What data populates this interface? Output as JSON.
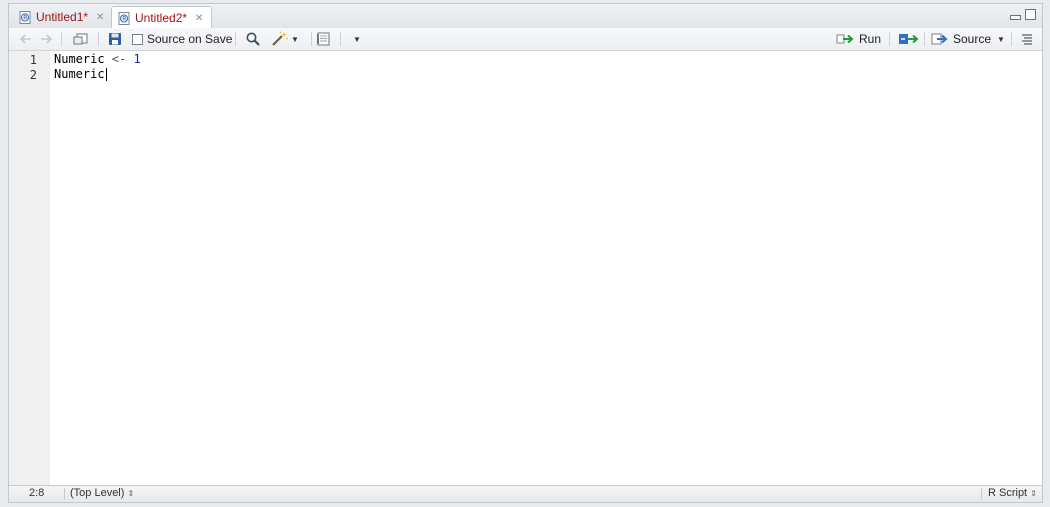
{
  "tabs": [
    {
      "label": "Untitled1*",
      "active": false
    },
    {
      "label": "Untitled2*",
      "active": true
    }
  ],
  "toolbar": {
    "source_on_save_label": "Source on Save",
    "source_on_save_checked": false,
    "run_label": "Run",
    "source_label": "Source"
  },
  "editor": {
    "line_numbers": [
      "1",
      "2"
    ],
    "lines": [
      {
        "ident": "Numeric",
        "op": " <- ",
        "num": "1"
      },
      {
        "ident": "Numeric",
        "op": "",
        "num": ""
      }
    ]
  },
  "status": {
    "cursor_pos": "2:8",
    "scope": "(Top Level)",
    "file_type": "R Script"
  },
  "colors": {
    "tab_text": "#a3141a",
    "number": "#1f1fa8",
    "run_arrow": "#1d9a3a",
    "rerun_arrow": "#2d6fc4"
  },
  "icons": {
    "back": "arrow-left-icon",
    "forward": "arrow-right-icon",
    "show_in_window": "popout-icon",
    "save": "floppy-disk-icon",
    "find": "magnifier-icon",
    "code_tools": "magic-wand-icon",
    "compile_report": "notebook-icon",
    "run": "run-arrow-icon",
    "rerun": "rerun-icon",
    "source": "source-icon",
    "outline": "outline-icon"
  }
}
